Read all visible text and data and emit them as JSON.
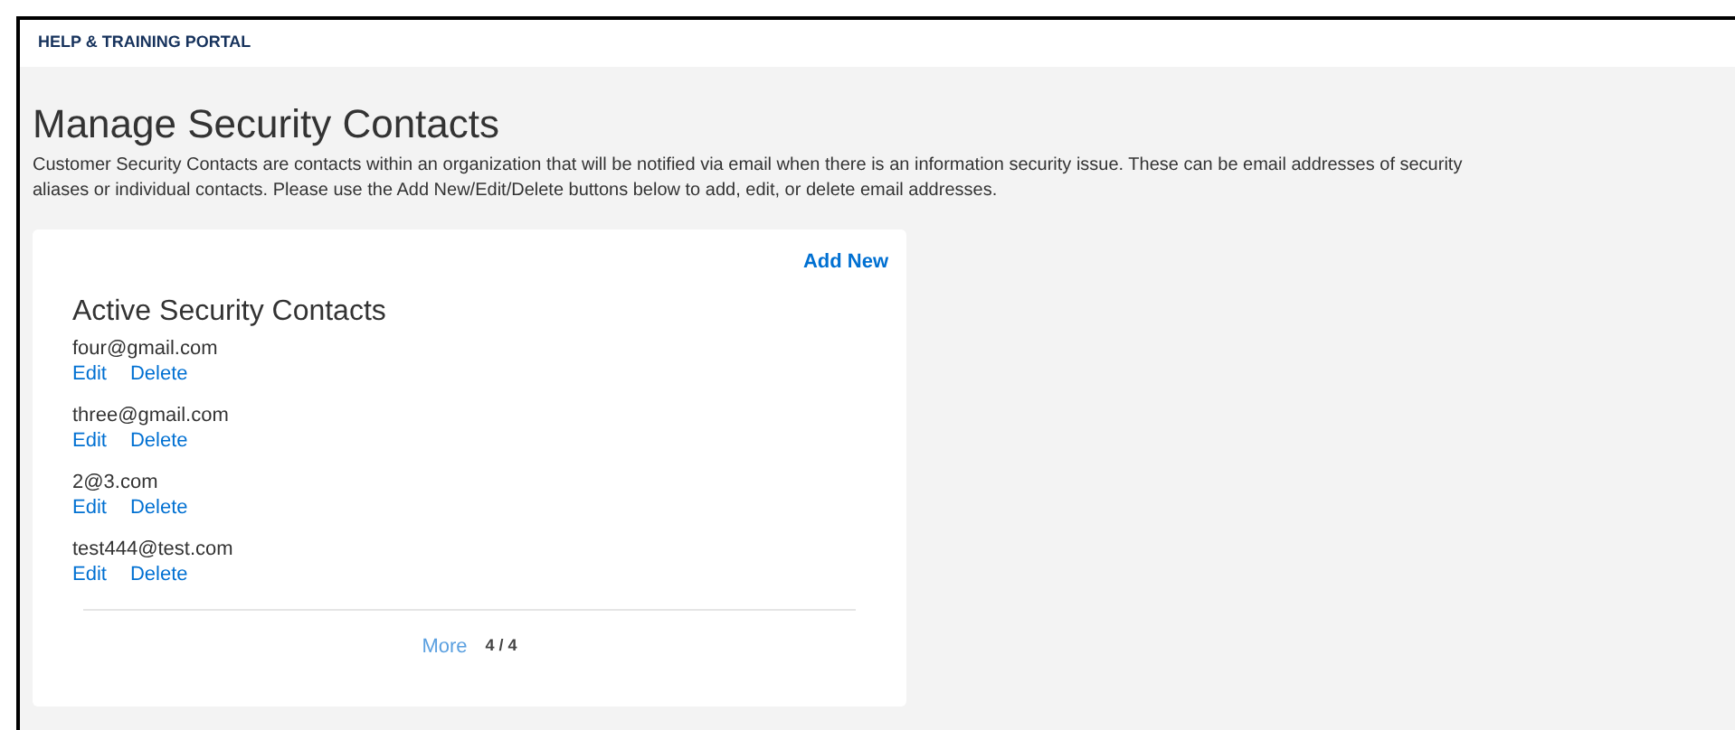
{
  "header": {
    "title": "HELP & TRAINING PORTAL"
  },
  "page": {
    "title": "Manage Security Contacts",
    "description_lines": [
      "Customer Security Contacts are contacts within an organization that will be notified via email when there is an information security issue. These can be email addresses of security",
      "aliases or individual contacts. Please use the Add New/Edit/Delete buttons below to add, edit, or delete email addresses."
    ]
  },
  "card": {
    "add_new": "Add New",
    "title": "Active Security Contacts",
    "contacts": [
      {
        "email": "four@gmail.com",
        "actions": [
          "Edit",
          "Delete"
        ]
      },
      {
        "email": "three@gmail.com",
        "actions": [
          "Edit",
          "Delete"
        ]
      },
      {
        "email": "2@3.com",
        "actions": [
          "Edit",
          "Delete"
        ]
      },
      {
        "email": "test444@test.com",
        "actions": [
          "Edit",
          "Delete"
        ]
      }
    ],
    "more": "More",
    "count": "4 / 4"
  }
}
